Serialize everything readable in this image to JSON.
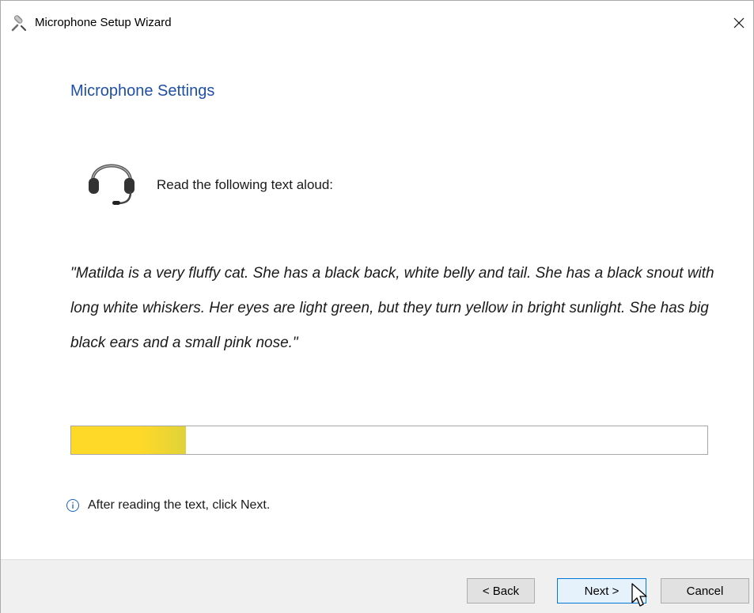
{
  "window": {
    "title": "Microphone Setup Wizard",
    "close_glyph": "✕"
  },
  "page": {
    "heading": "Microphone Settings",
    "instruction": "Read the following text aloud:",
    "passage": "\"Matilda is a very fluffy cat. She has a black back, white belly and tail. She has a black snout with long white whiskers. Her eyes are light green, but they turn yellow in bright sunlight. She has big black ears and a small pink nose.\"",
    "progress_fraction": 0.18,
    "hint": "After reading the text, click Next."
  },
  "buttons": {
    "back_label": "< Back",
    "next_label": "Next >",
    "cancel_label": "Cancel"
  },
  "icons": {
    "title_icon": "microphone-icon",
    "headset_icon": "headset-icon",
    "info_icon": "info-icon",
    "close_icon": "close-icon"
  },
  "colors": {
    "heading": "#1f4fa8",
    "progress": "#ffd928",
    "accent_border": "#0078d7"
  }
}
